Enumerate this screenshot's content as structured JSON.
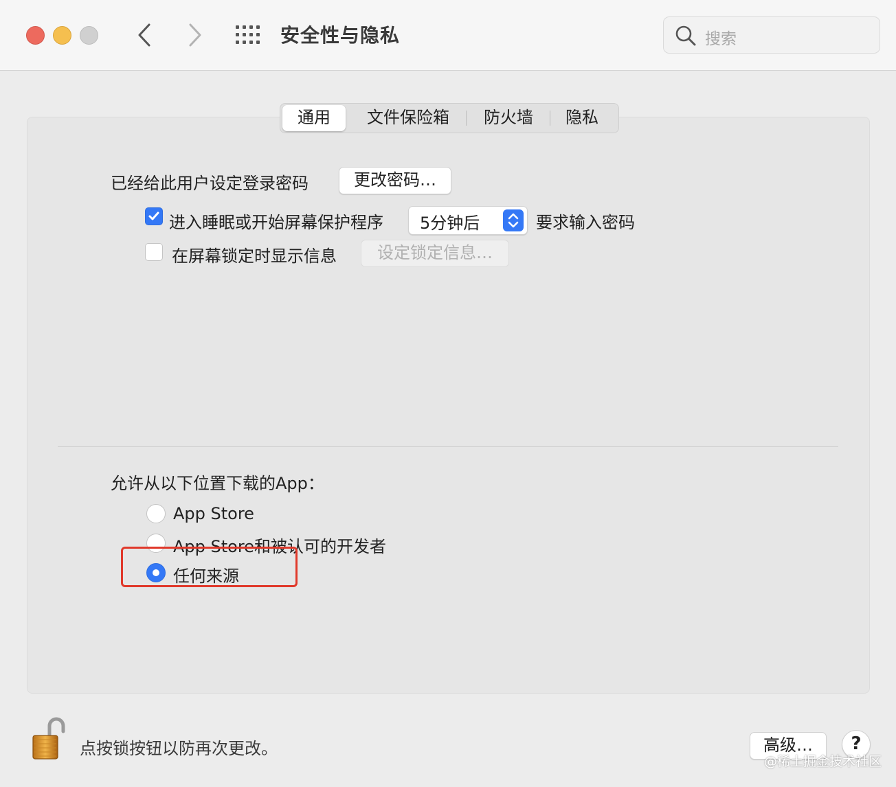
{
  "window": {
    "title": "安全性与隐私",
    "search_placeholder": "搜索"
  },
  "tabs": [
    {
      "label": "通用",
      "active": true
    },
    {
      "label": "文件保险箱",
      "active": false
    },
    {
      "label": "防火墙",
      "active": false
    },
    {
      "label": "隐私",
      "active": false
    }
  ],
  "general": {
    "password_set_label": "已经给此用户设定登录密码",
    "change_password_button": "更改密码…",
    "require_password": {
      "checked": true,
      "prefix_label": "进入睡眠或开始屏幕保护程序",
      "delay_value": "5分钟后",
      "suffix_label": "要求输入密码"
    },
    "show_message": {
      "checked": false,
      "label": "在屏幕锁定时显示信息",
      "set_message_button": "设定锁定信息…"
    }
  },
  "downloads": {
    "heading": "允许从以下位置下载的App：",
    "options": [
      {
        "label": "App Store",
        "selected": false
      },
      {
        "label": "App Store和被认可的开发者",
        "selected": false
      },
      {
        "label": "任何来源",
        "selected": true
      }
    ]
  },
  "footer": {
    "lock_hint": "点按锁按钮以防再次更改。",
    "advanced_button": "高级…",
    "help_button": "?",
    "watermark": "@稀土掘金技术社区"
  },
  "colors": {
    "accent": "#3478f6",
    "highlight": "#e0392b",
    "close": "#ed6a5e",
    "minimize": "#f5bf4f"
  }
}
